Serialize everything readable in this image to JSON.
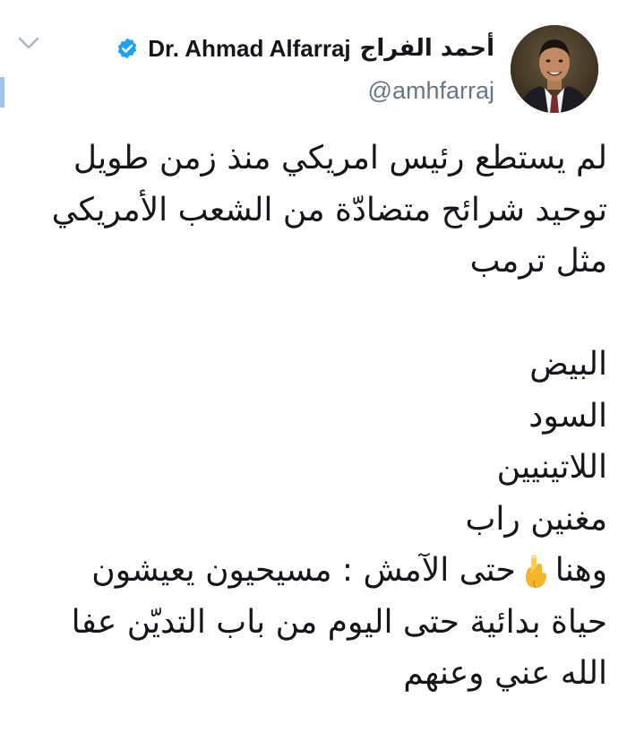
{
  "author": {
    "display_name_arabic": "أحمد الفراج",
    "display_name_english": "Dr. Ahmad Alfarraj",
    "handle": "@amhfarraj",
    "verified": true
  },
  "icons": {
    "menu": "chevron-down-icon",
    "verified": "verified-badge-icon",
    "emoji": "backhand-index-pointing-down-emoji"
  },
  "colors": {
    "text": "#14171a",
    "handle": "#657786",
    "verified_blue": "#1da1f2",
    "accent_bar": "#9fc4e8"
  },
  "tweet": {
    "lines": [
      "لم يستطع رئيس امريكي منذ زمن طويل",
      "توحيد شرائح متضادّة من الشعب الأمريكي",
      "مثل ترمب",
      "",
      "البيض",
      "السود",
      "اللاتينيين",
      "مغنين راب"
    ],
    "line9_before_emoji": "وهنا",
    "line9_after_emoji": "حتى الآمش : مسيحيون يعيشون",
    "line10": "حياة بدائية حتى اليوم من باب التديّن عفا",
    "line11": "الله عني وعنهم"
  }
}
